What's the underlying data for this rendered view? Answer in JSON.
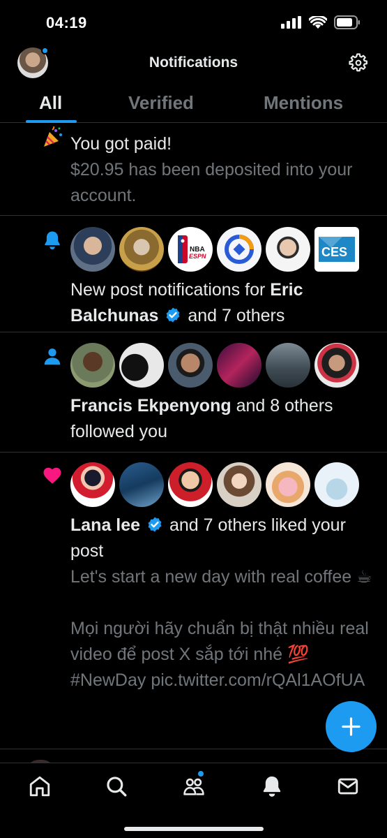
{
  "status_bar": {
    "time": "04:19"
  },
  "header": {
    "title": "Notifications"
  },
  "tabs": [
    {
      "label": "All",
      "active": true
    },
    {
      "label": "Verified",
      "active": false
    },
    {
      "label": "Mentions",
      "active": false
    }
  ],
  "notifications": [
    {
      "icon": "party-popper-icon",
      "title": "You got paid!",
      "detail": "$20.95 has been deposited into your account."
    },
    {
      "icon": "bell-icon",
      "prefix": "New post notifications for ",
      "name": "Eric Balchunas",
      "suffix": " and 7 others",
      "avatar_labels": [
        "",
        "",
        "NBA ESPN",
        "",
        "",
        "CES"
      ]
    },
    {
      "icon": "person-icon",
      "name": "Francis Ekpenyong",
      "suffix": " and 8 others followed you"
    },
    {
      "icon": "heart-icon",
      "name": "Lana lee",
      "suffix": " and 7 others liked your post",
      "post_line1": "Let's start a new day with real coffee ☕",
      "post_line2": "Mọi người hãy chuẩn bị thật nhiều real video để post X sắp tới nhé 💯 #NewDay pic.twitter.com/rQAl1AOfUA"
    }
  ],
  "colors": {
    "accent": "#1d9bf0",
    "heart": "#f91880",
    "background": "#000000",
    "text_primary": "#e7e9ea",
    "text_secondary": "#71767b"
  },
  "bottom_nav": [
    {
      "name": "home-icon"
    },
    {
      "name": "search-icon"
    },
    {
      "name": "communities-icon"
    },
    {
      "name": "bell-icon"
    },
    {
      "name": "mail-icon"
    }
  ]
}
